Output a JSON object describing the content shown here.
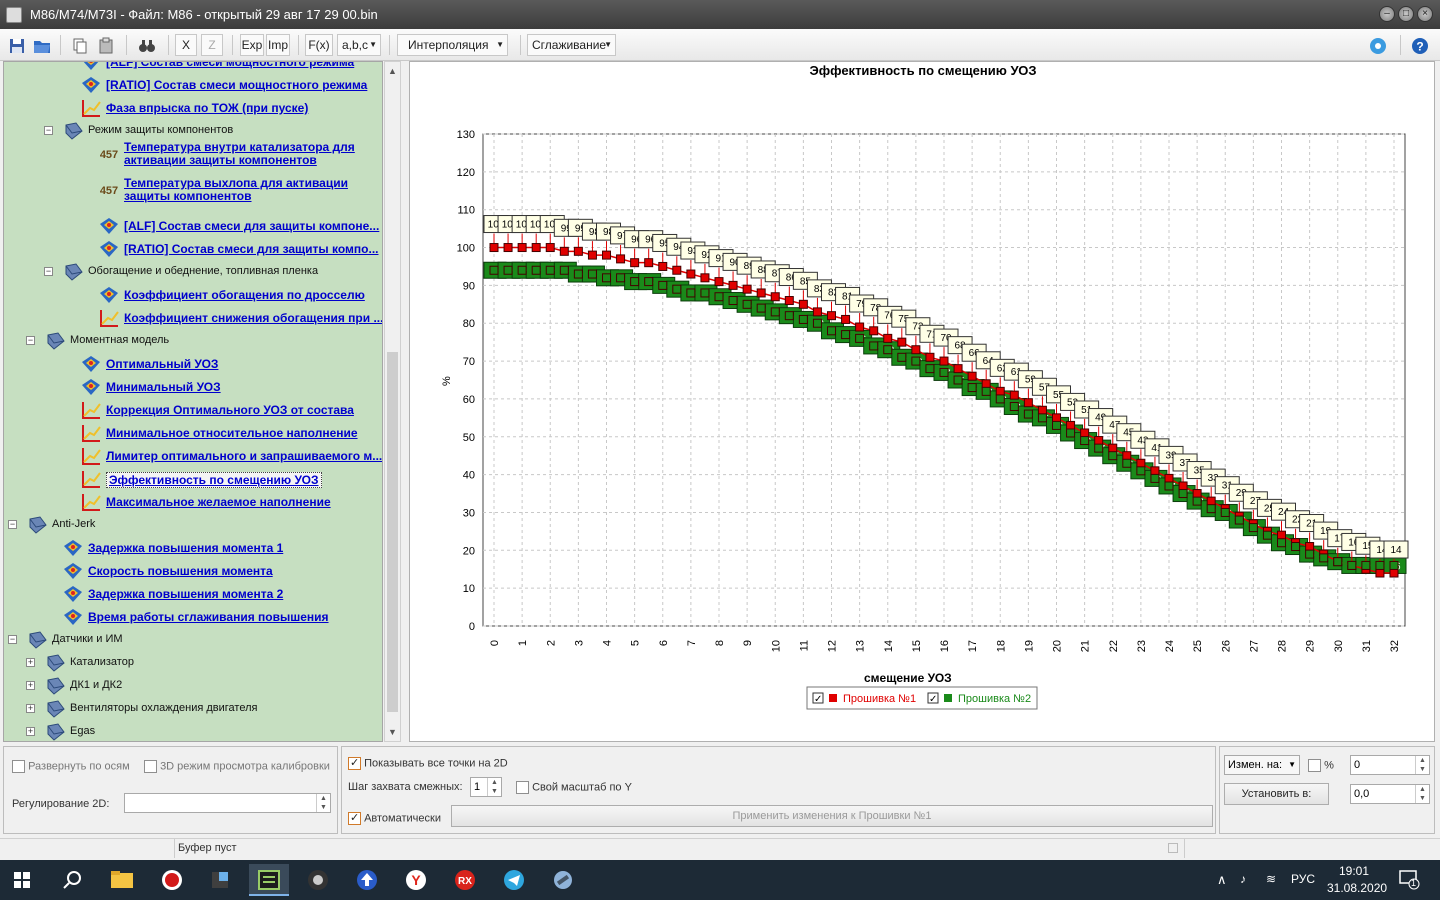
{
  "window": {
    "title": "M86/M74/M73I - Файл: M86 - открытый 29 авг 17 29 00.bin"
  },
  "toolbar": {
    "x_label": "X",
    "z_label": "Z",
    "exp_label": "Exp",
    "imp_label": "Imp",
    "fx_label": "F(x)",
    "abc_label": "a,b,c",
    "interp_label": "Интерполяция",
    "smooth_label": "Сглаживание"
  },
  "tree": {
    "items": [
      {
        "text": "[ALF] Состав смеси мощностного режима",
        "kind": "link",
        "icon": "map-3d-icon",
        "level": 3
      },
      {
        "text": "[RATIO] Состав смеси мощностного режима",
        "kind": "link",
        "icon": "map-3d-icon",
        "level": 3
      },
      {
        "text": "Фаза впрыска по ТОЖ (при пуске)",
        "kind": "link",
        "icon": "graph-2d-icon",
        "level": 3
      },
      {
        "text": "Режим защиты компонентов",
        "kind": "folder",
        "icon": "folder-icon",
        "level": 2,
        "expanded": true
      },
      {
        "text": "Температура внутри катализатора для|активации защиты компонентов",
        "kind": "link2",
        "icon": "constant-icon",
        "level": 4
      },
      {
        "text": "Температура выхлопа для активации|защиты компонентов",
        "kind": "link2",
        "icon": "constant-icon",
        "level": 4
      },
      {
        "text": "[ALF] Состав смеси для защиты компоне...",
        "kind": "link",
        "icon": "map-3d-icon",
        "level": 4
      },
      {
        "text": "[RATIO] Состав смеси для защиты компо...",
        "kind": "link",
        "icon": "map-3d-icon",
        "level": 4
      },
      {
        "text": "Обогащение и обеднение, топливная пленка",
        "kind": "folder",
        "icon": "folder-icon",
        "level": 2,
        "expanded": true
      },
      {
        "text": "Коэффициент обогащения по дросселю",
        "kind": "link",
        "icon": "map-3d-icon",
        "level": 4
      },
      {
        "text": "Коэффициент снижения обогащения при ...",
        "kind": "link",
        "icon": "graph-2d-icon",
        "level": 4
      },
      {
        "text": "Моментная модель",
        "kind": "folder",
        "icon": "folder-icon",
        "level": 1,
        "expanded": true
      },
      {
        "text": "Оптимальный УОЗ",
        "kind": "link",
        "icon": "map-3d-icon",
        "level": 3
      },
      {
        "text": "Минимальный УОЗ",
        "kind": "link",
        "icon": "map-3d-icon",
        "level": 3
      },
      {
        "text": "Коррекция Оптимального УОЗ от состава",
        "kind": "link",
        "icon": "graph-2d-icon",
        "level": 3
      },
      {
        "text": "Минимальное относительное наполнение",
        "kind": "link",
        "icon": "graph-2d-icon",
        "level": 3
      },
      {
        "text": "Лимитер оптимального и запрашиваемого м...",
        "kind": "link",
        "icon": "graph-2d-icon",
        "level": 3
      },
      {
        "text": "Эффективность по смещению УОЗ",
        "kind": "link",
        "icon": "graph-2d-icon",
        "level": 3,
        "selected": true
      },
      {
        "text": "Максимальное желаемое наполнение",
        "kind": "link",
        "icon": "graph-2d-icon",
        "level": 3
      },
      {
        "text": "Anti-Jerk",
        "kind": "folder",
        "icon": "folder-icon",
        "level": 0,
        "expanded": true
      },
      {
        "text": "Задержка повышения момента 1",
        "kind": "link",
        "icon": "map-3d-icon",
        "level": 2
      },
      {
        "text": "Скорость повышения момента",
        "kind": "link",
        "icon": "map-3d-icon",
        "level": 2
      },
      {
        "text": "Задержка повышения момента 2",
        "kind": "link",
        "icon": "map-3d-icon",
        "level": 2
      },
      {
        "text": "Время работы сглаживания повышения",
        "kind": "link",
        "icon": "map-3d-icon",
        "level": 2
      },
      {
        "text": "Датчики и ИМ",
        "kind": "folder",
        "icon": "folder-icon",
        "level": 0,
        "expanded": true
      },
      {
        "text": "Катализатор",
        "kind": "folder",
        "icon": "folder-icon",
        "level": 1,
        "expanded": false
      },
      {
        "text": "ДК1 и ДК2",
        "kind": "folder",
        "icon": "folder-icon",
        "level": 1,
        "expanded": false
      },
      {
        "text": "Вентиляторы охлаждения двигателя",
        "kind": "folder",
        "icon": "folder-icon",
        "level": 1,
        "expanded": false
      },
      {
        "text": "Egas",
        "kind": "folder",
        "icon": "folder-icon",
        "level": 1,
        "expanded": false
      }
    ]
  },
  "chart_data": {
    "type": "line",
    "title": "Эффективность по смещению УОЗ",
    "xlabel": "смещение УОЗ",
    "ylabel": "%",
    "x": [
      0,
      0.5,
      1,
      1.5,
      2,
      2.5,
      3,
      3.5,
      4,
      4.5,
      5,
      5.5,
      6,
      6.5,
      7,
      7.5,
      8,
      8.5,
      9,
      9.5,
      10,
      10.5,
      11,
      11.5,
      12,
      12.5,
      13,
      13.5,
      14,
      14.5,
      15,
      15.5,
      16,
      16.5,
      17,
      17.5,
      18,
      18.5,
      19,
      19.5,
      20,
      20.5,
      21,
      21.5,
      22,
      22.5,
      23,
      23.5,
      24,
      24.5,
      25,
      25.5,
      26,
      26.5,
      27,
      27.5,
      28,
      28.5,
      29,
      29.5,
      30,
      30.5,
      31,
      31.5,
      32
    ],
    "xticks": [
      "0",
      "1",
      "2",
      "3",
      "4",
      "5",
      "6",
      "7",
      "8",
      "9",
      "10",
      "11",
      "12",
      "13",
      "14",
      "15",
      "16",
      "17",
      "18",
      "19",
      "20",
      "21",
      "22",
      "23",
      "24",
      "25",
      "26",
      "27",
      "28",
      "29",
      "30",
      "31",
      "32"
    ],
    "ylim": [
      0,
      130
    ],
    "yticks": [
      0,
      10,
      20,
      30,
      40,
      50,
      60,
      70,
      80,
      90,
      100,
      110,
      120,
      130
    ],
    "grid": true,
    "legend": "bottom",
    "series": [
      {
        "name": "Прошивка №1",
        "color": "#e00000",
        "values": [
          100,
          100,
          100,
          100,
          100,
          99,
          99,
          98,
          98,
          97,
          96,
          96,
          95,
          94,
          93,
          92,
          91,
          90,
          89,
          88,
          87,
          86,
          85,
          83,
          82,
          81,
          79,
          78,
          76,
          75,
          73,
          71,
          70,
          68,
          66,
          64,
          62,
          61,
          59,
          57,
          55,
          53,
          51,
          49,
          47,
          45,
          43,
          41,
          39,
          37,
          35,
          33,
          31,
          29,
          27,
          25,
          24,
          22,
          21,
          19,
          17,
          16,
          15,
          14,
          14
        ]
      },
      {
        "name": "Прошивка №2",
        "color": "#1a8a1a",
        "values": [
          94,
          94,
          94,
          94,
          94,
          94,
          93,
          93,
          92,
          92,
          91,
          91,
          90,
          89,
          88,
          88,
          87,
          86,
          85,
          84,
          83,
          82,
          81,
          80,
          78,
          77,
          76,
          74,
          73,
          71,
          70,
          68,
          67,
          65,
          63,
          62,
          60,
          58,
          56,
          55,
          53,
          51,
          49,
          47,
          45,
          43,
          41,
          39,
          37,
          35,
          33,
          31,
          30,
          28,
          26,
          24,
          22,
          21,
          19,
          18,
          17,
          16,
          16,
          16,
          16
        ]
      }
    ]
  },
  "bottom": {
    "expand_axes": "Развернуть по осям",
    "mode_3d": "3D режим просмотра калибровки",
    "reg2d_label": "Регулирование 2D:",
    "reg2d_value": "",
    "show_all_points": "Показывать все точки на 2D",
    "step_label": "Шаг захвата смежных:",
    "step_value": "1",
    "own_scale": "Свой масштаб по Y",
    "auto": "Автоматически",
    "apply_btn": "Применить изменения к Прошивки №1",
    "change_label": "Измен. на:",
    "percent": "%",
    "change_value": "0",
    "set_btn": "Установить в:",
    "set_value": "0,0"
  },
  "status": {
    "text": "Буфер пуст"
  },
  "taskbar": {
    "lang": "РУС",
    "time": "19:01",
    "date": "31.08.2020",
    "notif_count": "1"
  }
}
